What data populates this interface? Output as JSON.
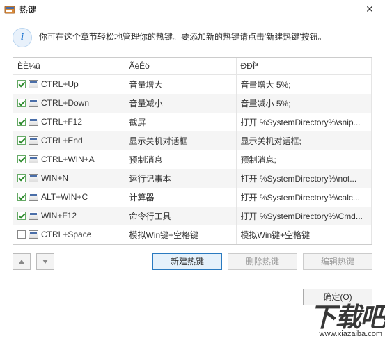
{
  "window": {
    "title": "热键",
    "close": "✕"
  },
  "info": {
    "text": "你可在这个章节轻松地管理你的热键。要添加新的热键请点击'新建热键'按钮。"
  },
  "columns": {
    "hotkey": "ÈÈ¼ü",
    "name": "ÃèÊö",
    "desc": "ÐÐÎª"
  },
  "rows": [
    {
      "checked": true,
      "hotkey": "CTRL+Up",
      "name": "音量增大",
      "desc": "音量增大 5%;"
    },
    {
      "checked": true,
      "hotkey": "CTRL+Down",
      "name": "音量减小",
      "desc": "音量减小 5%;"
    },
    {
      "checked": true,
      "hotkey": "CTRL+F12",
      "name": "截屏",
      "desc": "打开 %SystemDirectory%\\snip..."
    },
    {
      "checked": true,
      "hotkey": "CTRL+End",
      "name": "显示关机对话框",
      "desc": "显示关机对话框;"
    },
    {
      "checked": true,
      "hotkey": "CTRL+WIN+A",
      "name": "预制消息",
      "desc": "预制消息;"
    },
    {
      "checked": true,
      "hotkey": "WIN+N",
      "name": "运行记事本",
      "desc": "打开 %SystemDirectory%\\not..."
    },
    {
      "checked": true,
      "hotkey": "ALT+WIN+C",
      "name": "计算器",
      "desc": "打开 %SystemDirectory%\\calc..."
    },
    {
      "checked": true,
      "hotkey": "WIN+F12",
      "name": "命令行工具",
      "desc": "打开 %SystemDirectory%\\Cmd..."
    },
    {
      "checked": false,
      "hotkey": "CTRL+Space",
      "name": "模拟Win键+空格键",
      "desc": "模拟Win键+空格键"
    }
  ],
  "buttons": {
    "new": "新建热键",
    "delete": "删除热键",
    "edit": "编辑热键",
    "ok": "确定(O)"
  },
  "watermark": {
    "main": "下载吧",
    "sub": "www.xiazaiba.com"
  }
}
